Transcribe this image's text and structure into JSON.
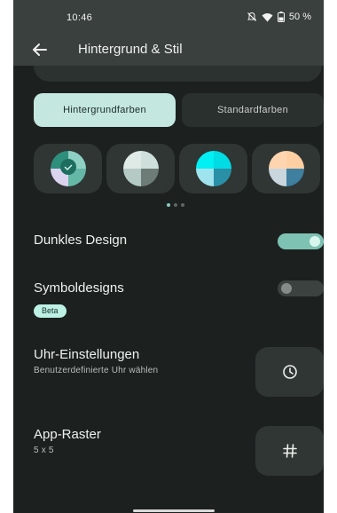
{
  "status": {
    "time": "10:46",
    "battery": "50 %",
    "icons": [
      "mute-icon",
      "wifi-icon",
      "battery-icon"
    ]
  },
  "appbar": {
    "title": "Hintergrund & Stil",
    "back_icon": "arrow-left-icon"
  },
  "color_source_tabs": [
    {
      "label": "Hintergrundfarben",
      "selected": true
    },
    {
      "label": "Standardfarben",
      "selected": false
    }
  ],
  "color_options": [
    {
      "selected": true,
      "colors": [
        "#2f8f7d",
        "#8fd0c4",
        "#dcd3ef",
        "#65b7a6"
      ]
    },
    {
      "selected": false,
      "colors": [
        "#dfe9e6",
        "#b6cac5",
        "#6e7c78",
        "#cfe0dc"
      ]
    },
    {
      "selected": false,
      "colors": [
        "#00f0f4",
        "#9fe3ee",
        "#2a90a8",
        "#00dce4"
      ]
    },
    {
      "selected": false,
      "colors": [
        "#ffd5b0",
        "#c9d6de",
        "#3f7fa0",
        "#ffcfa4"
      ]
    }
  ],
  "pager": {
    "count": 3,
    "active": 0
  },
  "settings": {
    "dark_theme": {
      "label": "Dunkles Design",
      "on": true
    },
    "themed_icons": {
      "label": "Symboldesigns",
      "badge": "Beta",
      "on": false
    },
    "clock": {
      "label": "Uhr-Einstellungen",
      "subtitle": "Benutzerdefinierte Uhr wählen",
      "icon": "clock-icon"
    },
    "app_grid": {
      "label": "App-Raster",
      "subtitle": "5 x 5",
      "icon": "grid-icon"
    }
  },
  "colors": {
    "background": "#1c2120",
    "bar": "#3a403e",
    "accent": "#7dc2b3",
    "selected_tab": "#c4e7df"
  }
}
